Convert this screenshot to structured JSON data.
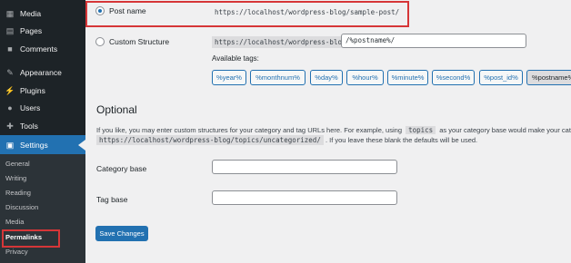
{
  "sidebar": {
    "items": [
      {
        "label": "Media",
        "icon": "media-icon"
      },
      {
        "label": "Pages",
        "icon": "pages-icon"
      },
      {
        "label": "Comments",
        "icon": "comments-icon"
      },
      {
        "label": "Appearance",
        "icon": "appearance-icon"
      },
      {
        "label": "Plugins",
        "icon": "plugins-icon"
      },
      {
        "label": "Users",
        "icon": "users-icon"
      },
      {
        "label": "Tools",
        "icon": "tools-icon"
      },
      {
        "label": "Settings",
        "icon": "settings-icon"
      }
    ],
    "submenu": [
      "General",
      "Writing",
      "Reading",
      "Discussion",
      "Media",
      "Permalinks",
      "Privacy"
    ]
  },
  "permalink": {
    "post_name_label": "Post name",
    "post_name_example": "https://localhost/wordpress-blog/sample-post/",
    "custom_label": "Custom Structure",
    "custom_base": "https://localhost/wordpress-blog",
    "custom_value": "/%postname%/",
    "available_tags_label": "Available tags:",
    "tags": [
      "%year%",
      "%monthnum%",
      "%day%",
      "%hour%",
      "%minute%",
      "%second%",
      "%post_id%",
      "%postname%"
    ]
  },
  "optional": {
    "heading": "Optional",
    "desc1_a": "If you like, you may enter custom structures for your category and tag URLs here. For example, using",
    "desc1_code": "topics",
    "desc1_b": "as your category base would make your category",
    "desc2_code": "https://localhost/wordpress-blog/topics/uncategorized/",
    "desc2_b": ". If you leave these blank the defaults will be used.",
    "category_base_label": "Category base",
    "category_base_value": "",
    "tag_base_label": "Tag base",
    "tag_base_value": ""
  },
  "actions": {
    "save_label": "Save Changes"
  },
  "colors": {
    "accent": "#2271b1",
    "sidebar": "#1d2327",
    "highlight": "#d63638"
  }
}
